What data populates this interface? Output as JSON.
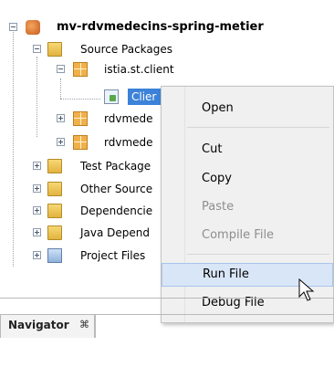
{
  "tree": {
    "project": "mv-rdvmedecins-spring-metier",
    "source_packages": "Source Packages",
    "package_client": "istia.st.client",
    "client_file": "Clier",
    "pkg2": "rdvmede",
    "pkg3": "rdvmede",
    "test_packages": "Test Package",
    "other_sources": "Other Source",
    "dependencies": "Dependencie",
    "java_dependencies": "Java Depend",
    "project_files": "Project Files"
  },
  "menu": {
    "open": "Open",
    "cut": "Cut",
    "copy": "Copy",
    "paste": "Paste",
    "compile_file": "Compile File",
    "run_file": "Run File",
    "debug_file": "Debug File"
  },
  "navigator": {
    "title": "Navigator",
    "close": "⌘"
  }
}
